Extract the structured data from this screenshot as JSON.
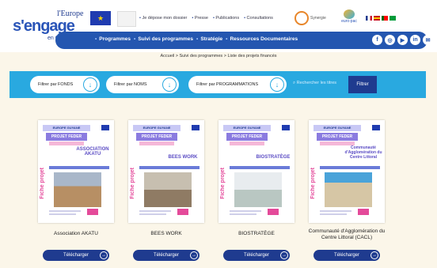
{
  "header": {
    "logo": {
      "line1": "l'Europe",
      "line2": "s'engage",
      "line3": "en Guyane"
    },
    "top_links": [
      "Je dépose mon dossier",
      "Presse",
      "Publications",
      "Consultations"
    ],
    "partner_text": "Synergie",
    "partner2_text": "euro-pac"
  },
  "nav": {
    "items": [
      "Programmes",
      "Suivi des programmes",
      "Stratégie",
      "Ressources Documentaires"
    ]
  },
  "breadcrumb": "Accueil  >  Suivi des programmes  >  Liste des projets financés",
  "filters": {
    "fonds": "Filtrer par FONDS",
    "noms": "Filtrer par NOMS",
    "programmations": "Filtrer par PROGRAMMATIONS",
    "search_placeholder": "Rechercher les titres",
    "filter_button": "Filtrer"
  },
  "cards": [
    {
      "title": "Association AKATU",
      "poster_name": "ASSOCIATION AKATU",
      "button": "Télécharger"
    },
    {
      "title": "BEES WORK",
      "poster_name": "BEES WORK",
      "button": "Télécharger"
    },
    {
      "title": "BIOSTRATÈGE",
      "poster_name": "BIOSTRATÈGE",
      "button": "Télécharger"
    },
    {
      "title": "Communauté d'Agglomération du Centre Littoral (CACL)",
      "poster_name": "Communauté d'Agglomération du Centre Littoral",
      "button": "Télécharger"
    }
  ],
  "poster": {
    "band1": "EUROPE GUYANE",
    "band2": "PROJET FEDER",
    "vertical": "Fiche projet"
  },
  "colors": {
    "nav_blue": "#2456b0",
    "filter_blue": "#29a9e0",
    "button_navy": "#1f3b8f",
    "accent_pink": "#e44a9a"
  }
}
